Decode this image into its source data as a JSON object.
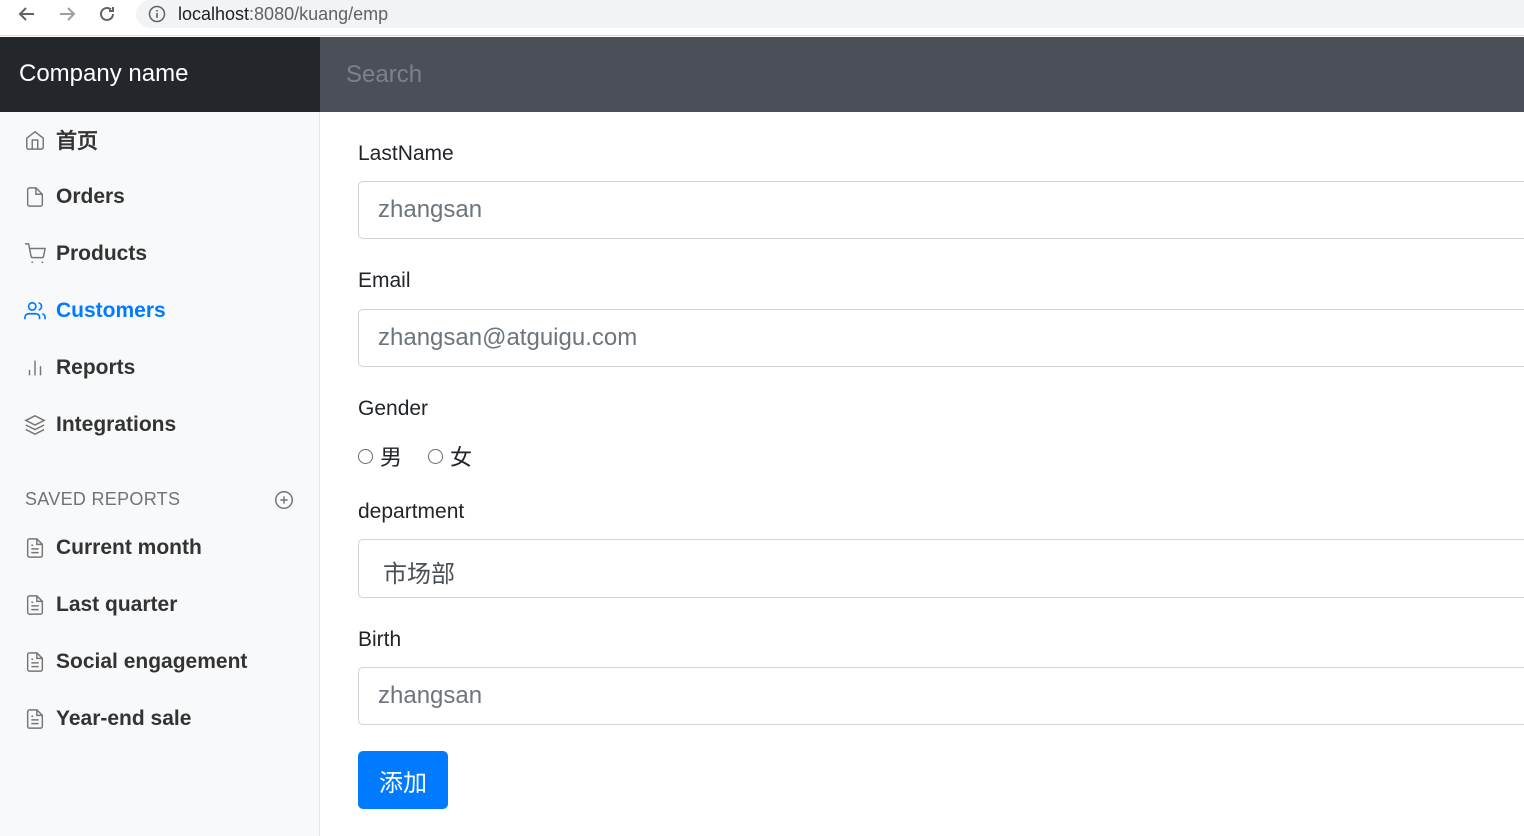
{
  "browser": {
    "url_host": "localhost",
    "url_rest": ":8080/kuang/emp"
  },
  "navbar": {
    "brand": "Company name",
    "search_placeholder": "Search"
  },
  "sidebar": {
    "items": [
      {
        "label": "首页",
        "icon": "home-icon"
      },
      {
        "label": "Orders",
        "icon": "file-icon"
      },
      {
        "label": "Products",
        "icon": "shopping-cart-icon"
      },
      {
        "label": "Customers",
        "icon": "users-icon",
        "active": true
      },
      {
        "label": "Reports",
        "icon": "bar-chart-icon"
      },
      {
        "label": "Integrations",
        "icon": "layers-icon"
      }
    ],
    "saved_reports_heading": "SAVED REPORTS",
    "saved_reports": [
      {
        "label": "Current month",
        "icon": "file-text-icon"
      },
      {
        "label": "Last quarter",
        "icon": "file-text-icon"
      },
      {
        "label": "Social engagement",
        "icon": "file-text-icon"
      },
      {
        "label": "Year-end sale",
        "icon": "file-text-icon"
      }
    ],
    "active_color": "#007bff"
  },
  "form": {
    "lastname_label": "LastName",
    "lastname_placeholder": "zhangsan",
    "email_label": "Email",
    "email_placeholder": "zhangsan@atguigu.com",
    "gender_label": "Gender",
    "gender_options": [
      "男",
      "女"
    ],
    "department_label": "department",
    "department_value": "市场部",
    "birth_label": "Birth",
    "birth_placeholder": "zhangsan",
    "submit_label": "添加"
  }
}
